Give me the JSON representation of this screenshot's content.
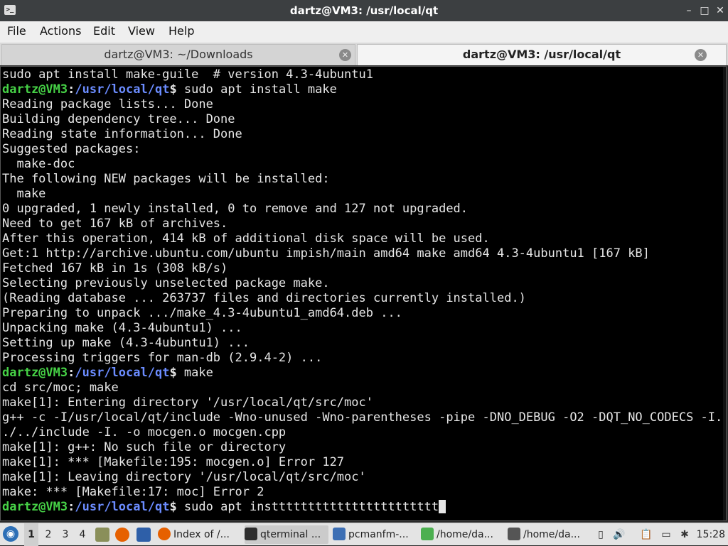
{
  "window": {
    "title": "dartz@VM3: /usr/local/qt",
    "app_icon_text": ">_",
    "minimize_glyph": "–",
    "maximize_glyph": "□",
    "close_glyph": "✕"
  },
  "menu": [
    "File",
    "Actions",
    "Edit",
    "View",
    "Help"
  ],
  "tabs": [
    {
      "label": "dartz@VM3: ~/Downloads",
      "active": false
    },
    {
      "label": "dartz@VM3: /usr/local/qt",
      "active": true
    }
  ],
  "tab_close_glyph": "✕",
  "prompt": {
    "user_host": "dartz@VM3",
    "colon": ":",
    "path": "/usr/local/qt",
    "sign": "$"
  },
  "terminal_lines": [
    {
      "type": "out",
      "text": "sudo apt install make-guile  # version 4.3-4ubuntu1"
    },
    {
      "type": "cmd",
      "text": " sudo apt install make"
    },
    {
      "type": "out",
      "text": "Reading package lists... Done"
    },
    {
      "type": "out",
      "text": "Building dependency tree... Done"
    },
    {
      "type": "out",
      "text": "Reading state information... Done"
    },
    {
      "type": "out",
      "text": "Suggested packages:"
    },
    {
      "type": "out",
      "text": "  make-doc"
    },
    {
      "type": "out",
      "text": "The following NEW packages will be installed:"
    },
    {
      "type": "out",
      "text": "  make"
    },
    {
      "type": "out",
      "text": "0 upgraded, 1 newly installed, 0 to remove and 127 not upgraded."
    },
    {
      "type": "out",
      "text": "Need to get 167 kB of archives."
    },
    {
      "type": "out",
      "text": "After this operation, 414 kB of additional disk space will be used."
    },
    {
      "type": "out",
      "text": "Get:1 http://archive.ubuntu.com/ubuntu impish/main amd64 make amd64 4.3-4ubuntu1 [167 kB]"
    },
    {
      "type": "out",
      "text": "Fetched 167 kB in 1s (308 kB/s)"
    },
    {
      "type": "out",
      "text": "Selecting previously unselected package make."
    },
    {
      "type": "out",
      "text": "(Reading database ... 263737 files and directories currently installed.)"
    },
    {
      "type": "out",
      "text": "Preparing to unpack .../make_4.3-4ubuntu1_amd64.deb ..."
    },
    {
      "type": "out",
      "text": "Unpacking make (4.3-4ubuntu1) ..."
    },
    {
      "type": "out",
      "text": "Setting up make (4.3-4ubuntu1) ..."
    },
    {
      "type": "out",
      "text": "Processing triggers for man-db (2.9.4-2) ..."
    },
    {
      "type": "cmd",
      "text": " make"
    },
    {
      "type": "out",
      "text": "cd src/moc; make"
    },
    {
      "type": "out",
      "text": "make[1]: Entering directory '/usr/local/qt/src/moc'"
    },
    {
      "type": "out",
      "text": "g++ -c -I/usr/local/qt/include -Wno-unused -Wno-parentheses -pipe -DNO_DEBUG -O2 -DQT_NO_CODECS -I."
    },
    {
      "type": "out",
      "text": "./../include -I. -o mocgen.o mocgen.cpp"
    },
    {
      "type": "out",
      "text": "make[1]: g++: No such file or directory"
    },
    {
      "type": "out",
      "text": "make[1]: *** [Makefile:195: mocgen.o] Error 127"
    },
    {
      "type": "out",
      "text": "make[1]: Leaving directory '/usr/local/qt/src/moc'"
    },
    {
      "type": "out",
      "text": "make: *** [Makefile:17: moc] Error 2"
    },
    {
      "type": "cmd",
      "text": " sudo apt insttttttttttttttttttttttt",
      "cursor": true
    }
  ],
  "taskbar": {
    "start_glyph": "◉",
    "workspaces": [
      "1",
      "2",
      "3",
      "4"
    ],
    "active_workspace": "1",
    "tasks": [
      {
        "label": "Index of /...",
        "icon": "firefox-icon",
        "color": "#e66000"
      },
      {
        "label": "qterminal ...",
        "icon": "terminal-icon",
        "color": "#2e2e2e"
      },
      {
        "label": "pcmanfm-...",
        "icon": "folder-icon",
        "color": "#3d6fb4"
      },
      {
        "label": "/home/da...",
        "icon": "text-editor-icon",
        "color": "#4caf50"
      },
      {
        "label": "/home/da...",
        "icon": "pen-icon",
        "color": "#555555"
      }
    ],
    "active_task": 1,
    "tray": {
      "battery_glyph": "▯",
      "volume_glyph": "🔊",
      "clipboard_glyph": "📋",
      "network_glyph": "▭",
      "bluetooth_glyph": "✱"
    },
    "clock": "15:28"
  },
  "colors": {
    "prompt_user": "#46d146",
    "prompt_path": "#6b8cff",
    "terminal_bg": "#000000",
    "terminal_fg": "#e6e6e6"
  }
}
